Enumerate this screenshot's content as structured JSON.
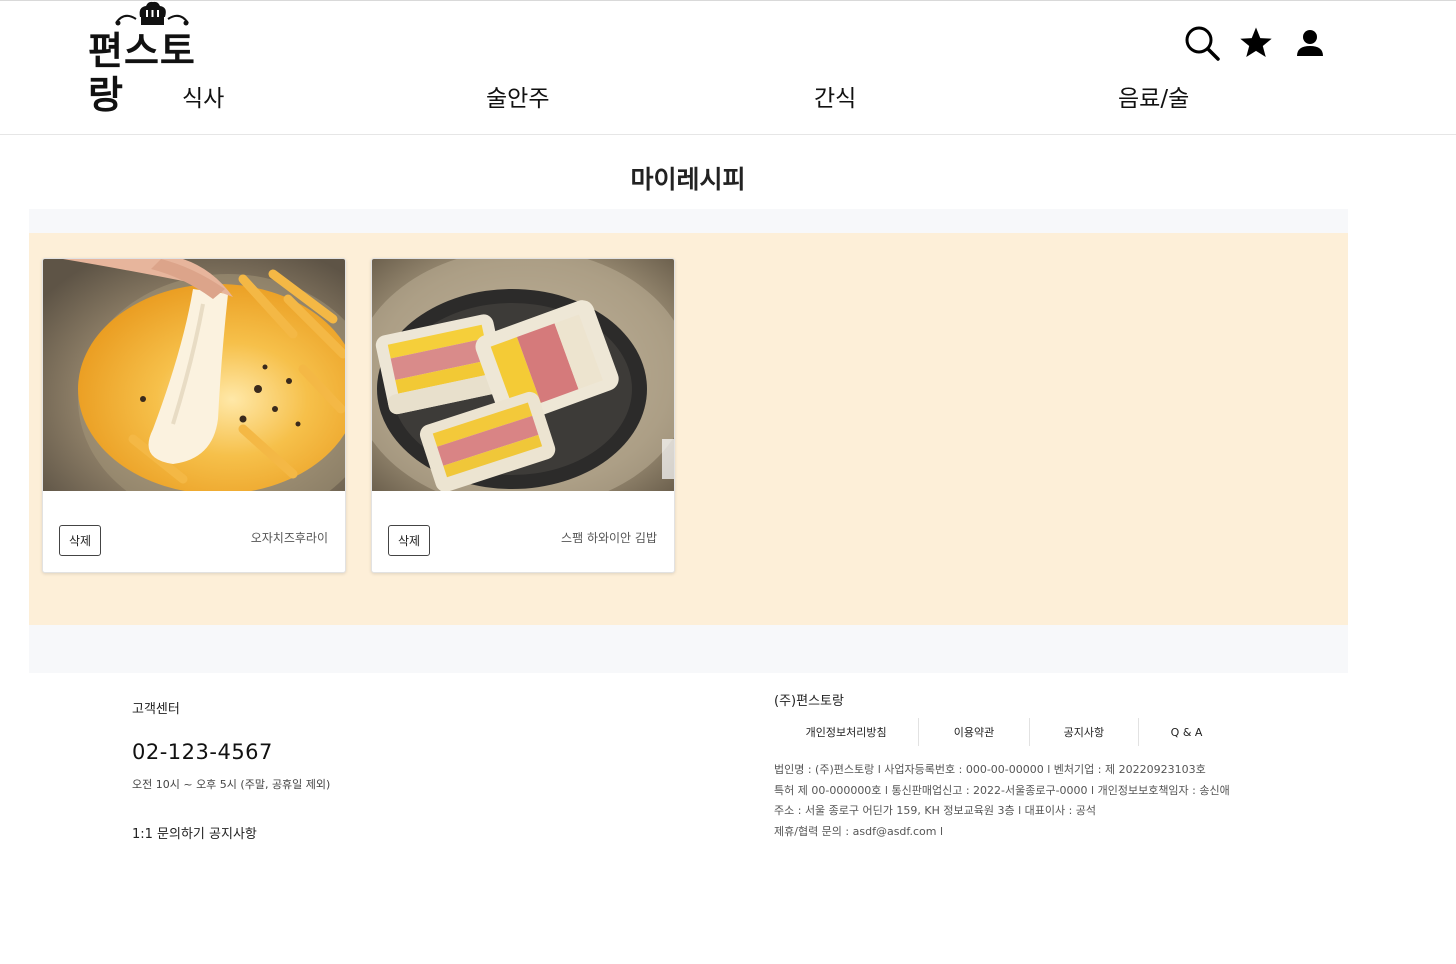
{
  "header": {
    "logo_text": "편스토랑",
    "nav": [
      "식사",
      "술안주",
      "간식",
      "음료/술"
    ],
    "icons": [
      "search-icon",
      "star-icon",
      "user-icon"
    ]
  },
  "page": {
    "title": "마이레시피"
  },
  "cards": [
    {
      "delete_label": "삭제",
      "name": "오자치즈후라이",
      "image": "cheese-fries-photo"
    },
    {
      "delete_label": "삭제",
      "name": "스팸 하와이안 김밥",
      "image": "spam-gimbap-photo"
    }
  ],
  "footer": {
    "left": {
      "label": "고객센터",
      "phone": "02-123-4567",
      "hours": "오전 10시 ~ 오후 5시 (주말, 공휴일 제외)",
      "link_inquiry": "1:1 문의하기",
      "link_notice": "공지사항"
    },
    "right": {
      "company": "(주)편스토랑",
      "menu": [
        "개인정보처리방침",
        "이용약관",
        "공지사항",
        "Q & A"
      ],
      "info": [
        "법인명 : (주)편스토랑 l 사업자등록번호 : 000-00-00000 l 벤처기업 : 제 20220923103호",
        "특허 제 00-000000호 l 통신판매업신고 : 2022-서울종로구-0000 l 개인정보보호책임자 : 송신애",
        "주소 : 서울 종로구 어딘가 159, KH 정보교육원 3층 l 대표이사 : 공석",
        "제휴/협력 문의 : asdf@asdf.com l"
      ]
    }
  },
  "colors": {
    "band": "#fdefd8",
    "band_outer": "#f7f8fa"
  }
}
